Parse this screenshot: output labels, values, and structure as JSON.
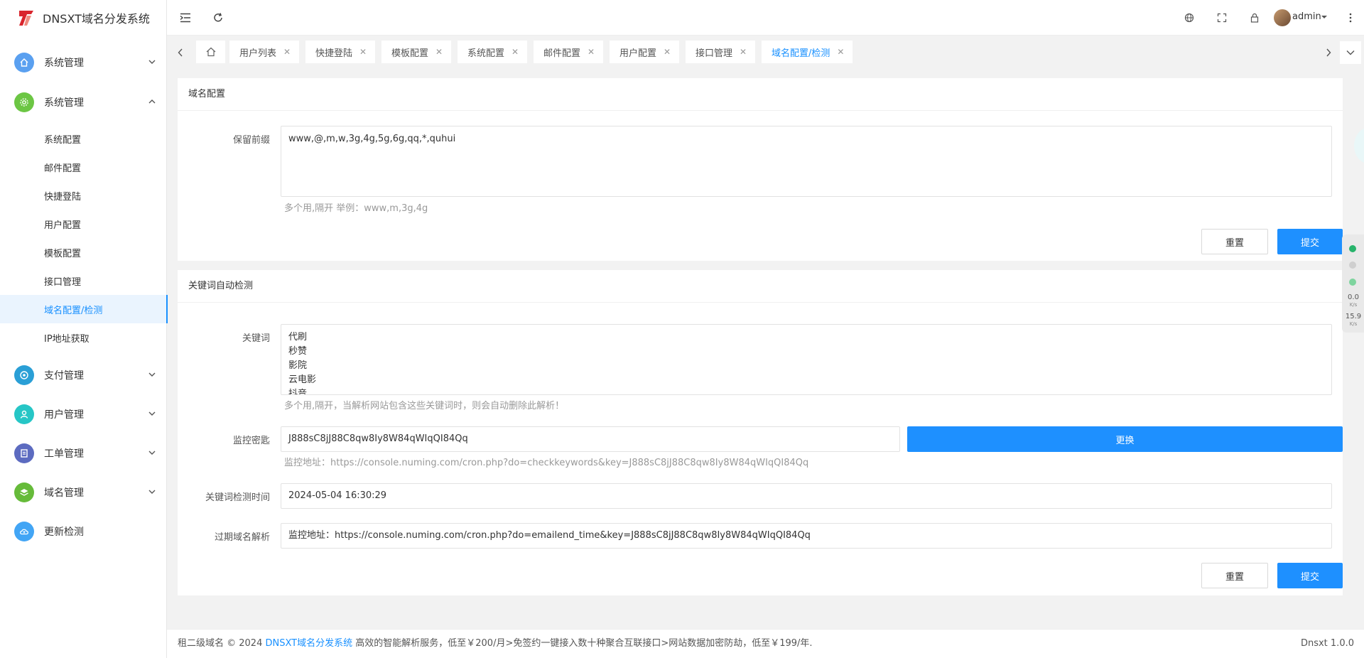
{
  "brand": {
    "title": "DNSXT域名分发系统",
    "logo_color": "#d9262e"
  },
  "header": {
    "user": "admin"
  },
  "sidebar": {
    "groups_top": [
      {
        "label": "系统管理",
        "color": "#5aa0f0",
        "icon": "home-icon",
        "expanded": false
      },
      {
        "label": "系统管理",
        "color": "#6cc644",
        "icon": "gear-icon",
        "expanded": true
      }
    ],
    "sub_items": [
      "系统配置",
      "邮件配置",
      "快捷登陆",
      "用户配置",
      "模板配置",
      "接口管理",
      "域名配置/检测",
      "IP地址获取"
    ],
    "groups_bottom": [
      {
        "label": "支付管理",
        "color": "#2a9fd6",
        "icon": "payment-icon"
      },
      {
        "label": "用户管理",
        "color": "#26c6c6",
        "icon": "user-icon"
      },
      {
        "label": "工单管理",
        "color": "#5c6bc0",
        "icon": "ticket-icon"
      },
      {
        "label": "域名管理",
        "color": "#66bb3a",
        "icon": "layers-icon"
      },
      {
        "label": "更新检测",
        "color": "#42a5f5",
        "icon": "cloud-update-icon"
      }
    ]
  },
  "tabs": [
    "用户列表",
    "快捷登陆",
    "模板配置",
    "系统配置",
    "邮件配置",
    "用户配置",
    "接口管理",
    "域名配置/检测"
  ],
  "domain_config": {
    "title": "域名配置",
    "prefix_label": "保留前缀",
    "prefix_value": "www,@,m,w,3g,4g,5g,6g,qq,*,quhui",
    "prefix_hint": "多个用,隔开 举例：www,m,3g,4g",
    "reset": "重置",
    "submit": "提交"
  },
  "keyword_check": {
    "title": "关键词自动检测",
    "keywords_label": "关键词",
    "keywords": [
      "代刷",
      "秒赞",
      "影院",
      "云电影",
      "抖音"
    ],
    "keywords_hint": "多个用,隔开，当解析网站包含这些关键词时，则会自动删除此解析！",
    "monitor_key_label": "监控密匙",
    "monitor_key_value": "J888sC8jJ88C8qw8Iy8W84qWIqQI84Qq",
    "replace_button": "更换",
    "monitor_url_hint": "监控地址：https://console.numing.com/cron.php?do=checkkeywords&key=J888sC8jJ88C8qw8Iy8W84qWIqQI84Qq",
    "check_time_label": "关键词检测时间",
    "check_time_value": "2024-05-04 16:30:29",
    "expired_label": "过期域名解析",
    "expired_value": "监控地址：https://console.numing.com/cron.php?do=emailend_time&key=J888sC8jJ88C8qw8Iy8W84qWIqQI84Qq",
    "reset": "重置",
    "submit": "提交"
  },
  "footer": {
    "prefix": "租二级域名 © 2024",
    "link": "DNSXT域名分发系统",
    "suffix": "高效的智能解析服务，低至￥200/月>免签约一键接入数十种聚合互联接口>网站数据加密防劫，低至￥199/年.",
    "version": "Dnsxt 1.0.0"
  },
  "net_widget": {
    "down": "0.0",
    "down_unit": "K/s",
    "up": "15.9",
    "up_unit": "K/s"
  },
  "colors": {
    "primary": "#1e90ff",
    "active_link": "#1890ff"
  }
}
